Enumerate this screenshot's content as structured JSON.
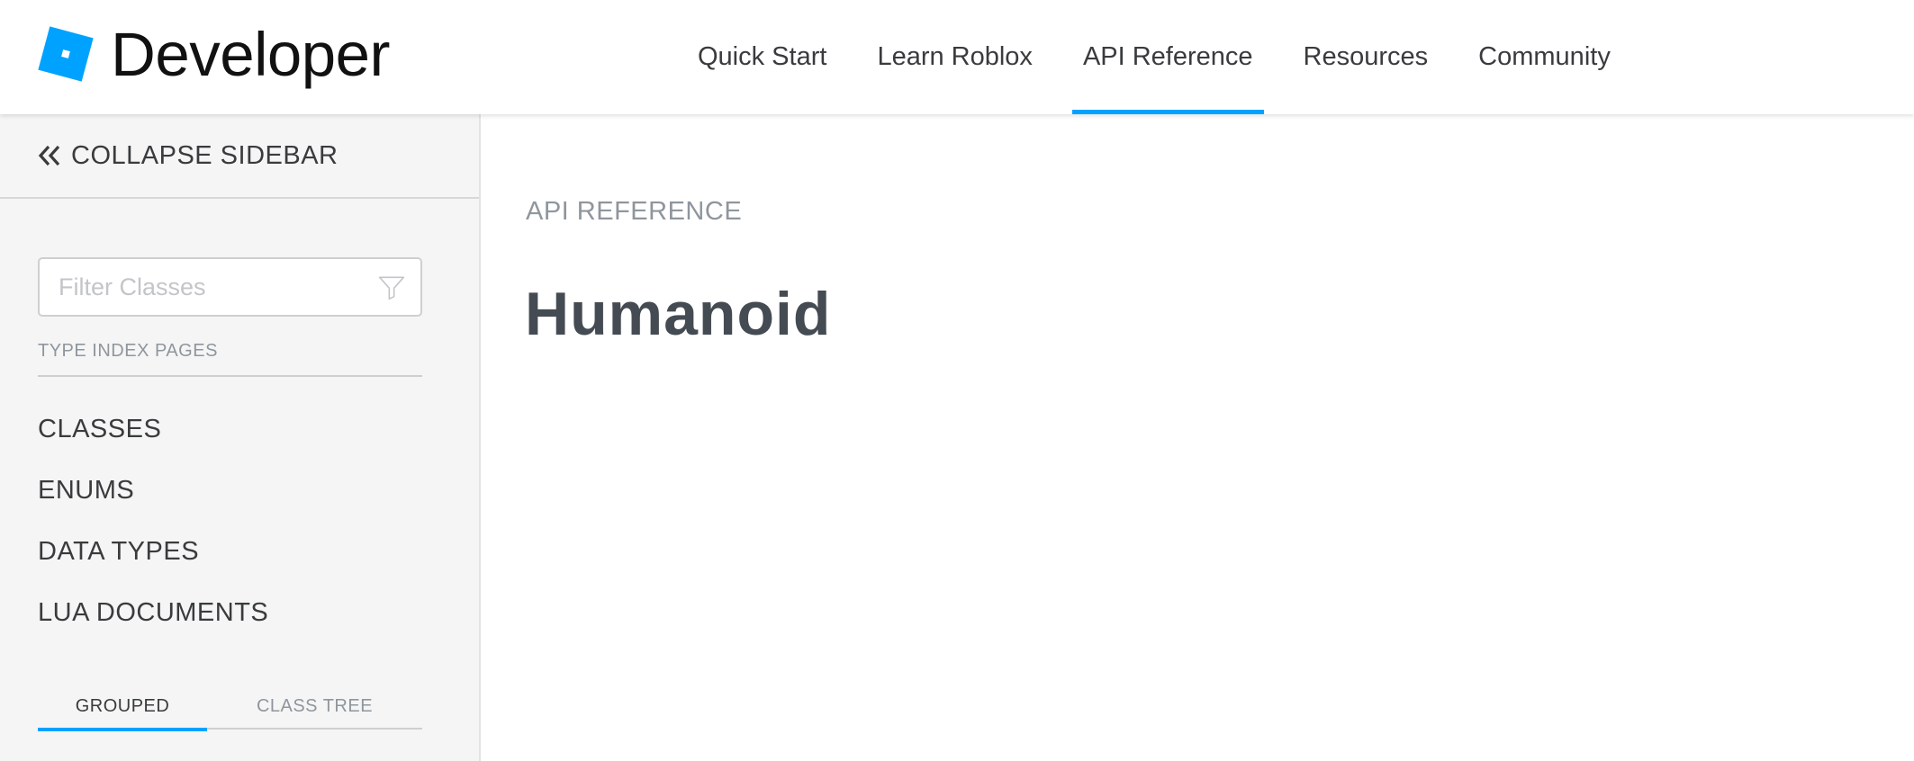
{
  "header": {
    "logo_text": "Developer",
    "nav": [
      {
        "label": "Quick Start",
        "active": false
      },
      {
        "label": "Learn Roblox",
        "active": false
      },
      {
        "label": "API Reference",
        "active": true
      },
      {
        "label": "Resources",
        "active": false
      },
      {
        "label": "Community",
        "active": false
      }
    ]
  },
  "sidebar": {
    "collapse_label": "COLLAPSE SIDEBAR",
    "filter": {
      "placeholder": "Filter Classes",
      "value": ""
    },
    "type_index_label": "TYPE INDEX PAGES",
    "type_items": [
      "CLASSES",
      "ENUMS",
      "DATA TYPES",
      "LUA DOCUMENTS"
    ],
    "tabs": [
      {
        "label": "GROUPED",
        "active": true
      },
      {
        "label": "CLASS TREE",
        "active": false
      }
    ]
  },
  "main": {
    "breadcrumb": "API REFERENCE",
    "title": "Humanoid"
  },
  "colors": {
    "accent": "#00a2ff",
    "logo_blue": "#00a2ff",
    "text": "#393b3d",
    "muted": "#8f969d",
    "title": "#454b52",
    "sidebar_bg": "#f5f5f5"
  },
  "icons": {
    "logo": "roblox-tilted-square-icon",
    "collapse": "double-chevron-left-icon",
    "filter": "funnel-icon"
  }
}
